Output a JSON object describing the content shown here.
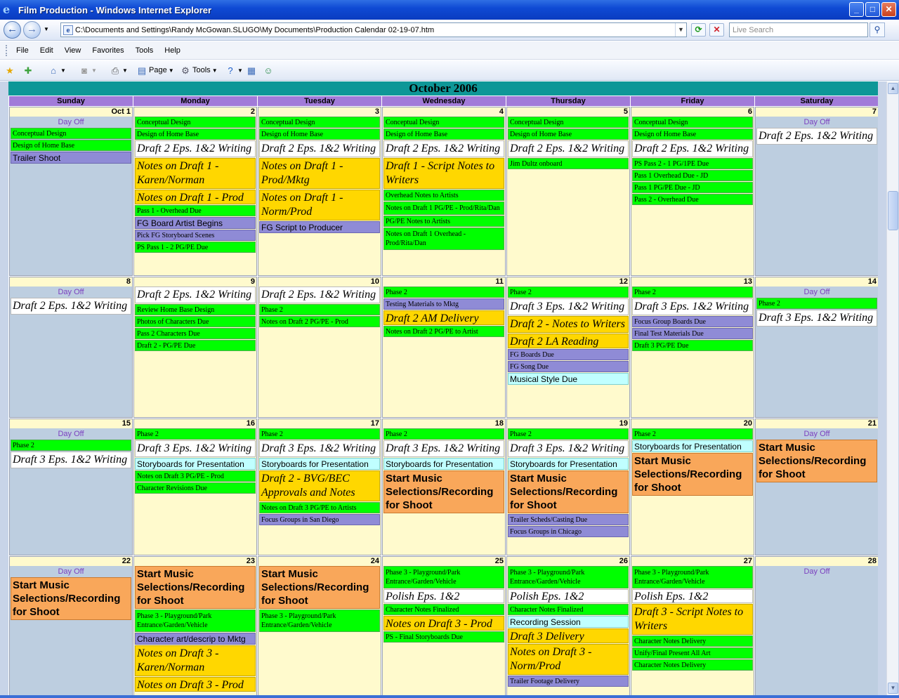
{
  "window": {
    "title": "Film Production - Windows Internet Explorer"
  },
  "address": {
    "url": "C:\\Documents and Settings\\Randy McGowan.SLUGO\\My Documents\\Production Calendar 02-19-07.htm",
    "search_placeholder": "Live Search"
  },
  "menu": [
    "File",
    "Edit",
    "View",
    "Favorites",
    "Tools",
    "Help"
  ],
  "toolbar": {
    "page": "Page",
    "tools": "Tools"
  },
  "calendar": {
    "month": "October 2006",
    "days": [
      "Sunday",
      "Monday",
      "Tuesday",
      "Wednesday",
      "Thursday",
      "Friday",
      "Saturday"
    ],
    "weeks": [
      [
        {
          "n": "Oct 1",
          "off": "Day Off",
          "ev": [
            [
              "e1",
              "Conceptual Design"
            ],
            [
              "e1",
              "Design of Home Base"
            ],
            [
              "e2s",
              "Trailer Shoot"
            ]
          ]
        },
        {
          "n": "2",
          "ev": [
            [
              "e1",
              "Conceptual Design"
            ],
            [
              "e1",
              "Design of Home Base"
            ],
            [
              "e3",
              "Draft 2 Eps. 1&2 Writing"
            ],
            [
              "e4",
              "Notes on Draft 1 - Karen/Norman"
            ],
            [
              "e4s",
              "Notes on Draft 1 - Prod"
            ],
            [
              "e1",
              "Pass 1 - Overhead Due"
            ],
            [
              "e2s",
              "FG Board Artist Begins"
            ],
            [
              "e2",
              "Pick FG Storyboard Scenes"
            ],
            [
              "e1",
              "PS Pass 1 - 2 PG/PE Due"
            ]
          ]
        },
        {
          "n": "3",
          "ev": [
            [
              "e1",
              "Conceptual Design"
            ],
            [
              "e1",
              "Design of Home Base"
            ],
            [
              "e3",
              "Draft 2 Eps. 1&2 Writing"
            ],
            [
              "e4",
              "Notes on Draft 1 - Prod/Mktg"
            ],
            [
              "e4",
              "Notes on Draft 1 - Norm/Prod"
            ],
            [
              "e2s",
              "FG Script to Producer"
            ]
          ]
        },
        {
          "n": "4",
          "ev": [
            [
              "e1",
              "Conceptual Design"
            ],
            [
              "e1",
              "Design of Home Base"
            ],
            [
              "e3",
              "Draft 2 Eps. 1&2 Writing"
            ],
            [
              "e4",
              "Draft 1 - Script Notes to Writers"
            ],
            [
              "e1",
              "Overhead Notes to Artists"
            ],
            [
              "e1m",
              "Notes on Draft 1 PG/PE - Prod/Rita/Dan"
            ],
            [
              "e1",
              "PG/PE Notes to Artists"
            ],
            [
              "e1m",
              "Notes on Draft 1 Overhead - Prod/Rita/Dan"
            ]
          ]
        },
        {
          "n": "5",
          "ev": [
            [
              "e1",
              "Conceptual Design"
            ],
            [
              "e1",
              "Design of Home Base"
            ],
            [
              "e3",
              "Draft 2 Eps. 1&2 Writing"
            ],
            [
              "e1",
              "Jim Dultz onboard"
            ]
          ]
        },
        {
          "n": "6",
          "ev": [
            [
              "e1",
              "Conceptual Design"
            ],
            [
              "e1",
              "Design of Home Base"
            ],
            [
              "e3",
              "Draft 2 Eps. 1&2 Writing"
            ],
            [
              "e1",
              "PS Pass 2 - 1 PG/1PE Due"
            ],
            [
              "e1",
              "Pass 1 Overhead Due - JD"
            ],
            [
              "e1",
              "Pass 1 PG/PE Due - JD"
            ],
            [
              "e1",
              "Pass 2 - Overhead Due"
            ]
          ]
        },
        {
          "n": "7",
          "off": "Day Off",
          "ev": [
            [
              "e3",
              "Draft 2 Eps. 1&2 Writing"
            ]
          ]
        }
      ],
      [
        {
          "n": "8",
          "off": "Day Off",
          "ev": [
            [
              "e3",
              "Draft 2 Eps. 1&2 Writing"
            ]
          ]
        },
        {
          "n": "9",
          "ev": [
            [
              "e3",
              "Draft 2 Eps. 1&2 Writing"
            ],
            [
              "e1",
              "Review Home Base Design"
            ],
            [
              "e1",
              "Photos of Characters Due"
            ],
            [
              "e1",
              "Pass 2 Characters Due"
            ],
            [
              "e1",
              "Draft 2 - PG/PE Due"
            ]
          ]
        },
        {
          "n": "10",
          "ev": [
            [
              "e3",
              "Draft 2 Eps. 1&2 Writing"
            ],
            [
              "e1",
              "Phase 2"
            ],
            [
              "e1",
              "Notes on Draft 2 PG/PE - Prod"
            ]
          ]
        },
        {
          "n": "11",
          "ev": [
            [
              "e1",
              "Phase 2"
            ],
            [
              "e2",
              "Testing Materials to Mktg"
            ],
            [
              "e4s",
              "Draft 2 AM Delivery"
            ],
            [
              "e1",
              "Notes on Draft 2 PG/PE to Artist"
            ]
          ]
        },
        {
          "n": "12",
          "ev": [
            [
              "e1",
              "Phase 2"
            ],
            [
              "e3",
              "Draft 3 Eps. 1&2 Writing"
            ],
            [
              "e4",
              "Draft 2 - Notes to Writers"
            ],
            [
              "e4s",
              "Draft 2 LA Reading"
            ],
            [
              "e2",
              "FG Boards Due"
            ],
            [
              "e2",
              "FG Song Due"
            ],
            [
              "e6",
              "Musical Style Due"
            ]
          ]
        },
        {
          "n": "13",
          "ev": [
            [
              "e1",
              "Phase 2"
            ],
            [
              "e3",
              "Draft 3 Eps. 1&2 Writing"
            ],
            [
              "e2",
              "Focus Group Boards Due"
            ],
            [
              "e2",
              "Final Test Materials Due"
            ],
            [
              "e1",
              "Draft 3 PG/PE Due"
            ]
          ]
        },
        {
          "n": "14",
          "off": "Day Off",
          "ev": [
            [
              "e1",
              "Phase 2"
            ],
            [
              "e3",
              "Draft 3 Eps. 1&2 Writing"
            ]
          ]
        }
      ],
      [
        {
          "n": "15",
          "off": "Day Off",
          "ev": [
            [
              "e1",
              "Phase 2"
            ],
            [
              "e3",
              "Draft 3 Eps. 1&2 Writing"
            ]
          ]
        },
        {
          "n": "16",
          "ev": [
            [
              "e1",
              "Phase 2"
            ],
            [
              "e3",
              "Draft 3 Eps. 1&2 Writing"
            ],
            [
              "e6",
              "Storyboards for Presentation"
            ],
            [
              "e1",
              "Notes on Draft 3 PG/PE - Prod"
            ],
            [
              "e1",
              "Character Revisions Due"
            ]
          ]
        },
        {
          "n": "17",
          "ev": [
            [
              "e1",
              "Phase 2"
            ],
            [
              "e3",
              "Draft 3 Eps. 1&2 Writing"
            ],
            [
              "e6",
              "Storyboards for Presentation"
            ],
            [
              "e4",
              "Draft 2 - BVG/BEC Approvals and Notes"
            ],
            [
              "e1",
              "Notes on Draft 3 PG/PE to Artists"
            ],
            [
              "e2",
              "Focus Groups in San Diego"
            ]
          ]
        },
        {
          "n": "18",
          "ev": [
            [
              "e1",
              "Phase 2"
            ],
            [
              "e3",
              "Draft 3 Eps. 1&2 Writing"
            ],
            [
              "e6",
              "Storyboards for Presentation"
            ],
            [
              "e5",
              "Start Music Selections/Recording for Shoot"
            ]
          ]
        },
        {
          "n": "19",
          "ev": [
            [
              "e1",
              "Phase 2"
            ],
            [
              "e3",
              "Draft 3 Eps. 1&2 Writing"
            ],
            [
              "e6",
              "Storyboards for Presentation"
            ],
            [
              "e5",
              "Start Music Selections/Recording for Shoot"
            ],
            [
              "e2",
              "Trailer Scheds/Casting Due"
            ],
            [
              "e2",
              "Focus Groups in Chicago"
            ]
          ]
        },
        {
          "n": "20",
          "ev": [
            [
              "e1",
              "Phase 2"
            ],
            [
              "e6",
              "Storyboards for Presentation"
            ],
            [
              "e5",
              "Start Music Selections/Recording for Shoot"
            ]
          ]
        },
        {
          "n": "21",
          "off": "Day Off",
          "ev": [
            [
              "e5",
              "Start Music Selections/Recording for Shoot"
            ]
          ]
        }
      ],
      [
        {
          "n": "22",
          "off": "Day Off",
          "ev": [
            [
              "e5",
              "Start Music Selections/Recording for Shoot"
            ]
          ]
        },
        {
          "n": "23",
          "ev": [
            [
              "e5",
              "Start Music Selections/Recording for Shoot"
            ],
            [
              "e1m",
              "Phase 3 - Playground/Park Entrance/Garden/Vehicle"
            ],
            [
              "e2s",
              "Character art/descrip to Mktg"
            ],
            [
              "e4",
              "Notes on Draft 3 - Karen/Norman"
            ],
            [
              "e4s",
              "Notes on Draft 3 - Prod"
            ]
          ]
        },
        {
          "n": "24",
          "ev": [
            [
              "e5",
              "Start Music Selections/Recording for Shoot"
            ],
            [
              "e1m",
              "Phase 3 - Playground/Park Entrance/Garden/Vehicle"
            ]
          ]
        },
        {
          "n": "25",
          "ev": [
            [
              "e1m",
              "Phase 3 - Playground/Park Entrance/Garden/Vehicle"
            ],
            [
              "e3s",
              "Polish Eps. 1&2"
            ],
            [
              "e1",
              "Character Notes Finalized"
            ],
            [
              "e4s",
              "Notes on Draft 3 - Prod"
            ],
            [
              "e1",
              "PS - Final Storyboards Due"
            ]
          ]
        },
        {
          "n": "26",
          "ev": [
            [
              "e1m",
              "Phase 3 - Playground/Park Entrance/Garden/Vehicle"
            ],
            [
              "e3s",
              "Polish Eps. 1&2"
            ],
            [
              "e1",
              "Character Notes Finalized"
            ],
            [
              "e6",
              "Recording Session"
            ],
            [
              "e4s",
              "Draft 3 Delivery"
            ],
            [
              "e4",
              "Notes on Draft 3 - Norm/Prod"
            ],
            [
              "e2",
              "Trailer Footage Delivery"
            ]
          ]
        },
        {
          "n": "27",
          "ev": [
            [
              "e1m",
              "Phase 3 - Playground/Park Entrance/Garden/Vehicle"
            ],
            [
              "e3s",
              "Polish Eps. 1&2"
            ],
            [
              "e4",
              "Draft 3 - Script Notes to Writers"
            ],
            [
              "e1",
              "Character Notes Delivery"
            ],
            [
              "e1",
              "Unify/Final Present All Art"
            ],
            [
              "e1",
              "Character Notes Delivery"
            ]
          ]
        },
        {
          "n": "28",
          "off": "Day Off",
          "ev": []
        }
      ]
    ]
  }
}
